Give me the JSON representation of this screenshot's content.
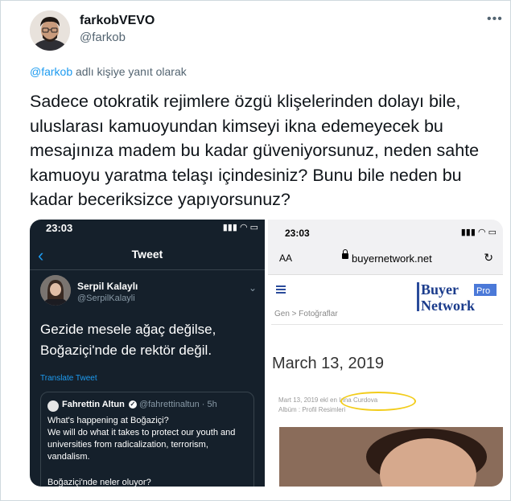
{
  "tweet": {
    "display_name": "farkobVEVO",
    "handle": "@farkob",
    "more_icon": "more-icon",
    "reply_link": "@farkob",
    "reply_suffix": " adlı kişiye yanıt olarak",
    "text": "Sadece otokratik rejimlere özgü klişelerinden dolayı bile, uluslarası kamuoyundan kimseyi ikna edemeyecek bu mesajınıza madem bu kadar güveniyorsunuz, neden sahte kamuoyu yaratma telaşı içindesiniz? Bunu bile neden bu kadar beceriksizce yapıyorsunuz?"
  },
  "left_screenshot": {
    "time": "23:03",
    "header_title": "Tweet",
    "author_name": "Serpil Kalaylı",
    "author_handle": "@SerpilKalayli",
    "text_line1": "Gezide mesele ağaç değilse,",
    "text_line2": "Boğaziçi'nde de rektör değil.",
    "translate": "Translate Tweet",
    "quote": {
      "author_name": "Fahrettin Altun",
      "author_handle": "@fahrettinaltun · 5h",
      "line1": "What's happening at Boğaziçi?",
      "line2": "We will do what it takes to protect our youth and universities from radicalization, terrorism, vandalism.",
      "line3": "Boğaziçi'nde neler oluyor?"
    }
  },
  "right_screenshot": {
    "time": "23:03",
    "aa": "AA",
    "url": "buyernetwork.net",
    "logo_word1": "Buyer",
    "logo_pro": "Pro",
    "logo_word2": "Network",
    "breadcrumb": "Gen  >  Fotoğraflar",
    "date": "March 13, 2019",
    "meta_line1": "Mart 13, 2019 ekl  en Irina Curdova",
    "meta_line2": "Albüm : Profil Resimleri"
  },
  "colors": {
    "link": "#1d9bf0",
    "dark_bg": "#15202b",
    "highlight": "#f2cc1a",
    "logo_blue": "#2a4b9b"
  }
}
